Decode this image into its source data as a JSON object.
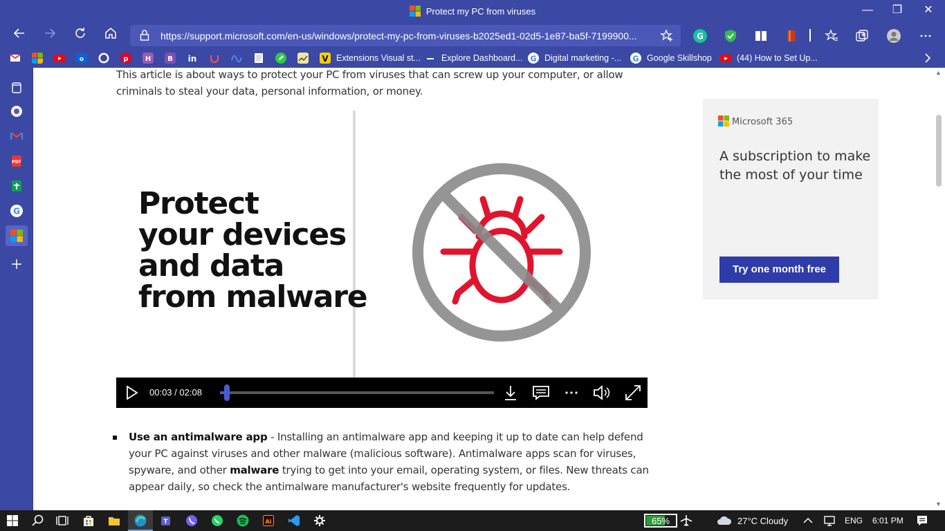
{
  "window": {
    "title": "Protect my PC from viruses",
    "controls": {
      "minimize": "—",
      "restore": "❐",
      "close": "✕"
    }
  },
  "navigation": {
    "url": "https://support.microsoft.com/en-us/windows/protect-my-pc-from-viruses-b2025ed1-02d5-1e87-ba5f-7199900...",
    "back_icon": "back-arrow-icon",
    "forward_icon": "forward-arrow-icon"
  },
  "bookmarks": [
    {
      "label": "Extensions Visual st..."
    },
    {
      "label": "Explore Dashboard..."
    },
    {
      "label": "Digital marketing -..."
    },
    {
      "label": "Google Skillshop"
    },
    {
      "label": "(44) How to Set Up..."
    }
  ],
  "article": {
    "intro": "This article is about ways to protect your PC from viruses that can screw up your computer, or allow criminals to steal your data, personal information, or money.",
    "video": {
      "headline_lines": [
        "Protect",
        "your devices",
        "and data",
        "from malware"
      ],
      "current_time": "00:03",
      "separator": "/",
      "duration": "02:08",
      "progress_fraction": 0.024
    },
    "bullet": {
      "title": "Use an antimalware app",
      "dash": " - ",
      "text_1": "Installing an antimalware app and keeping it up to date can help defend your PC against viruses and other malware (malicious software). Antimalware apps scan for viruses, spyware, and other ",
      "bold_word": "malware",
      "text_2": " trying to get into your email, operating system, or files. New threats can appear daily, so check the antimalware manufacturer's website frequently for updates."
    }
  },
  "ad": {
    "brand": "Microsoft 365",
    "tagline": "A subscription to make the most of your time",
    "cta": "Try one month free"
  },
  "taskbar": {
    "battery": "65%",
    "battery_fraction": 0.65,
    "weather": "27°C  Cloudy",
    "language": "ENG",
    "time": "6:01 PM"
  },
  "colors": {
    "chrome": "#3b48a4",
    "accent": "#2f3ba9",
    "bug_red": "#e0142e",
    "prohibit_gray": "#8a8a8a"
  }
}
